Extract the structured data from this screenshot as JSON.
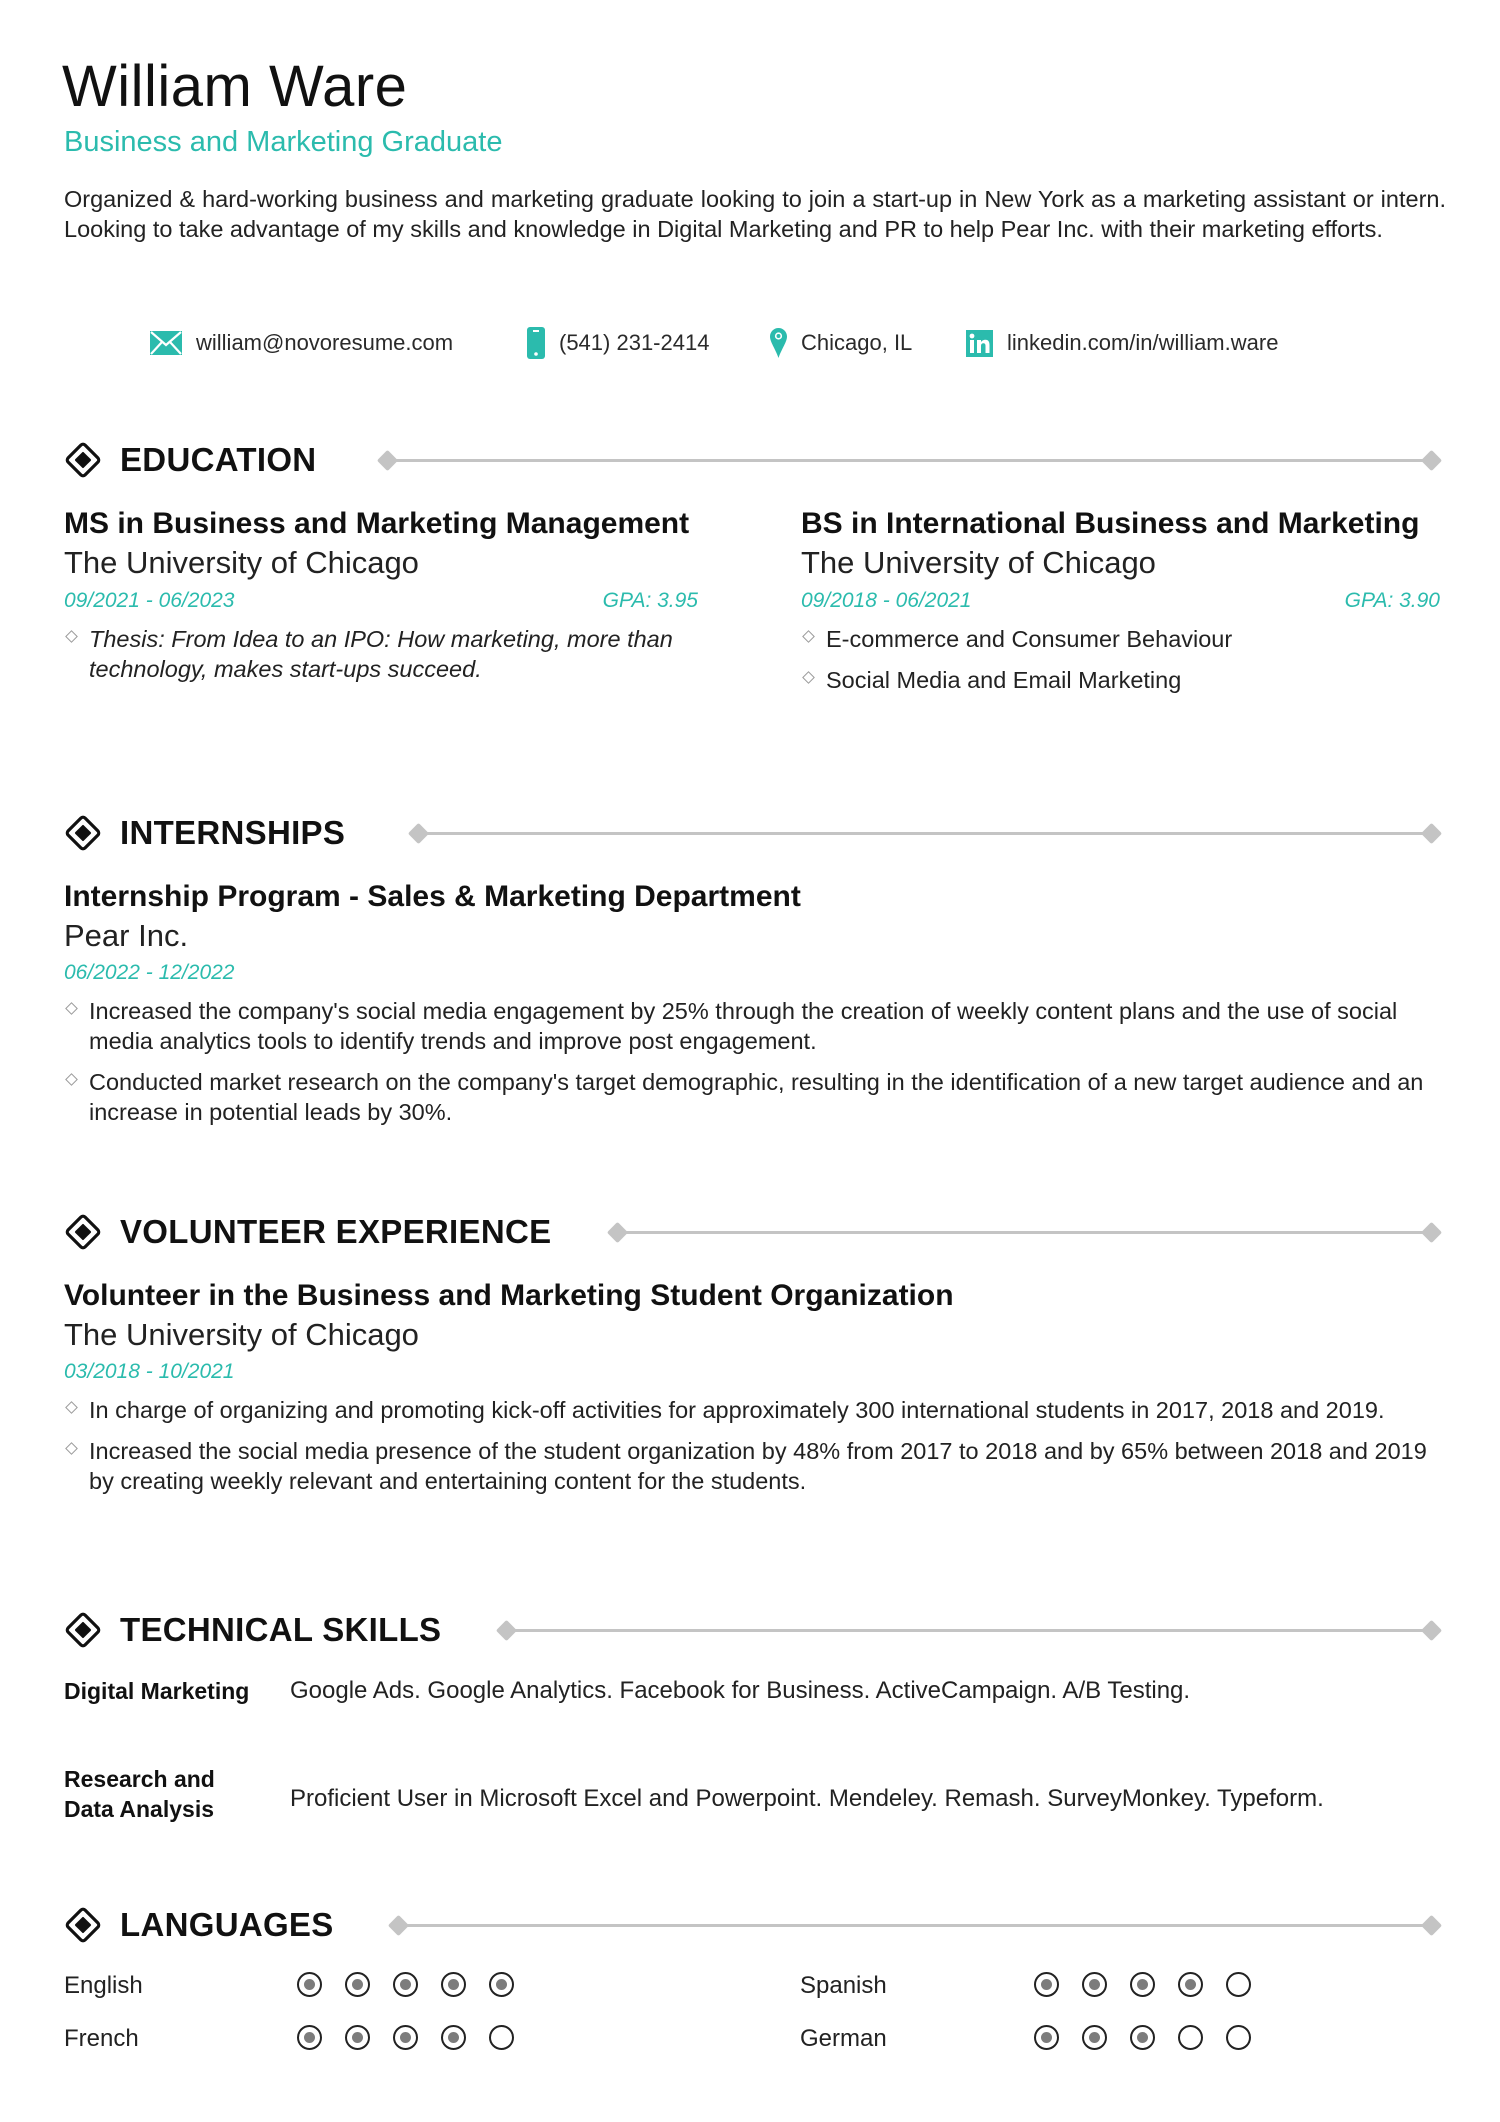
{
  "header": {
    "name": "William Ware",
    "title": "Business and Marketing Graduate",
    "summary": "Organized & hard-working business and marketing graduate looking to join a start-up in New York as a marketing assistant or intern. Looking to take advantage of my skills and knowledge in Digital Marketing and PR to help Pear Inc. with their marketing efforts."
  },
  "contact": [
    {
      "icon": "envelope-icon",
      "text": "william@novoresume.com"
    },
    {
      "icon": "phone-icon",
      "text": "(541) 231-2414"
    },
    {
      "icon": "location-pin-icon",
      "text": "Chicago, IL"
    },
    {
      "icon": "linkedin-icon",
      "text": "linkedin.com/in/william.ware"
    }
  ],
  "accent_color": "#2bbbad",
  "sections": {
    "education": "EDUCATION",
    "internships": "INTERNSHIPS",
    "volunteer": "VOLUNTEER EXPERIENCE",
    "skills": "TECHNICAL SKILLS",
    "languages": "LANGUAGES"
  },
  "education": [
    {
      "degree": "MS in Business and Marketing Management",
      "school": "The University of Chicago",
      "dates": "09/2021 - 06/2023",
      "gpa": "GPA: 3.95",
      "bullets": [
        "Thesis: From Idea to an IPO: How marketing, more than technology, makes start-ups succeed."
      ]
    },
    {
      "degree": "BS in International Business and Marketing",
      "school": "The University of Chicago",
      "dates": "09/2018 - 06/2021",
      "gpa": "GPA: 3.90",
      "bullets": [
        "E-commerce and Consumer Behaviour",
        "Social Media and Email Marketing"
      ]
    }
  ],
  "internships": [
    {
      "title": "Internship Program - Sales & Marketing Department",
      "company": "Pear Inc.",
      "dates": "06/2022 - 12/2022",
      "bullets": [
        "Increased the company's social media engagement by 25% through the creation of weekly content plans and the use of social media analytics tools to identify trends and improve post engagement.",
        "Conducted market research on the company's target demographic, resulting in the identification of a new target audience and an increase in potential leads by 30%."
      ]
    }
  ],
  "volunteer": [
    {
      "title": "Volunteer in the Business and Marketing Student Organization",
      "org": "The University of Chicago",
      "dates": "03/2018 - 10/2021",
      "bullets": [
        "In charge of organizing and promoting kick-off activities for approximately 300 international students in 2017, 2018 and 2019.",
        "Increased the social media presence of the student organization by 48% from 2017 to 2018 and by 65% between 2018 and 2019 by creating weekly relevant and entertaining content for the students."
      ]
    }
  ],
  "skills": [
    {
      "label": "Digital Marketing",
      "value": "Google Ads. Google Analytics. Facebook for Business. ActiveCampaign. A/B Testing."
    },
    {
      "label": "Research and Data Analysis",
      "value": "Proficient User in Microsoft Excel and Powerpoint. Mendeley. Remash. SurveyMonkey. Typeform."
    }
  ],
  "languages": [
    {
      "name": "English",
      "level": 5,
      "max": 5
    },
    {
      "name": "Spanish",
      "level": 4,
      "max": 5
    },
    {
      "name": "French",
      "level": 4,
      "max": 5
    },
    {
      "name": "German",
      "level": 3,
      "max": 5
    }
  ]
}
